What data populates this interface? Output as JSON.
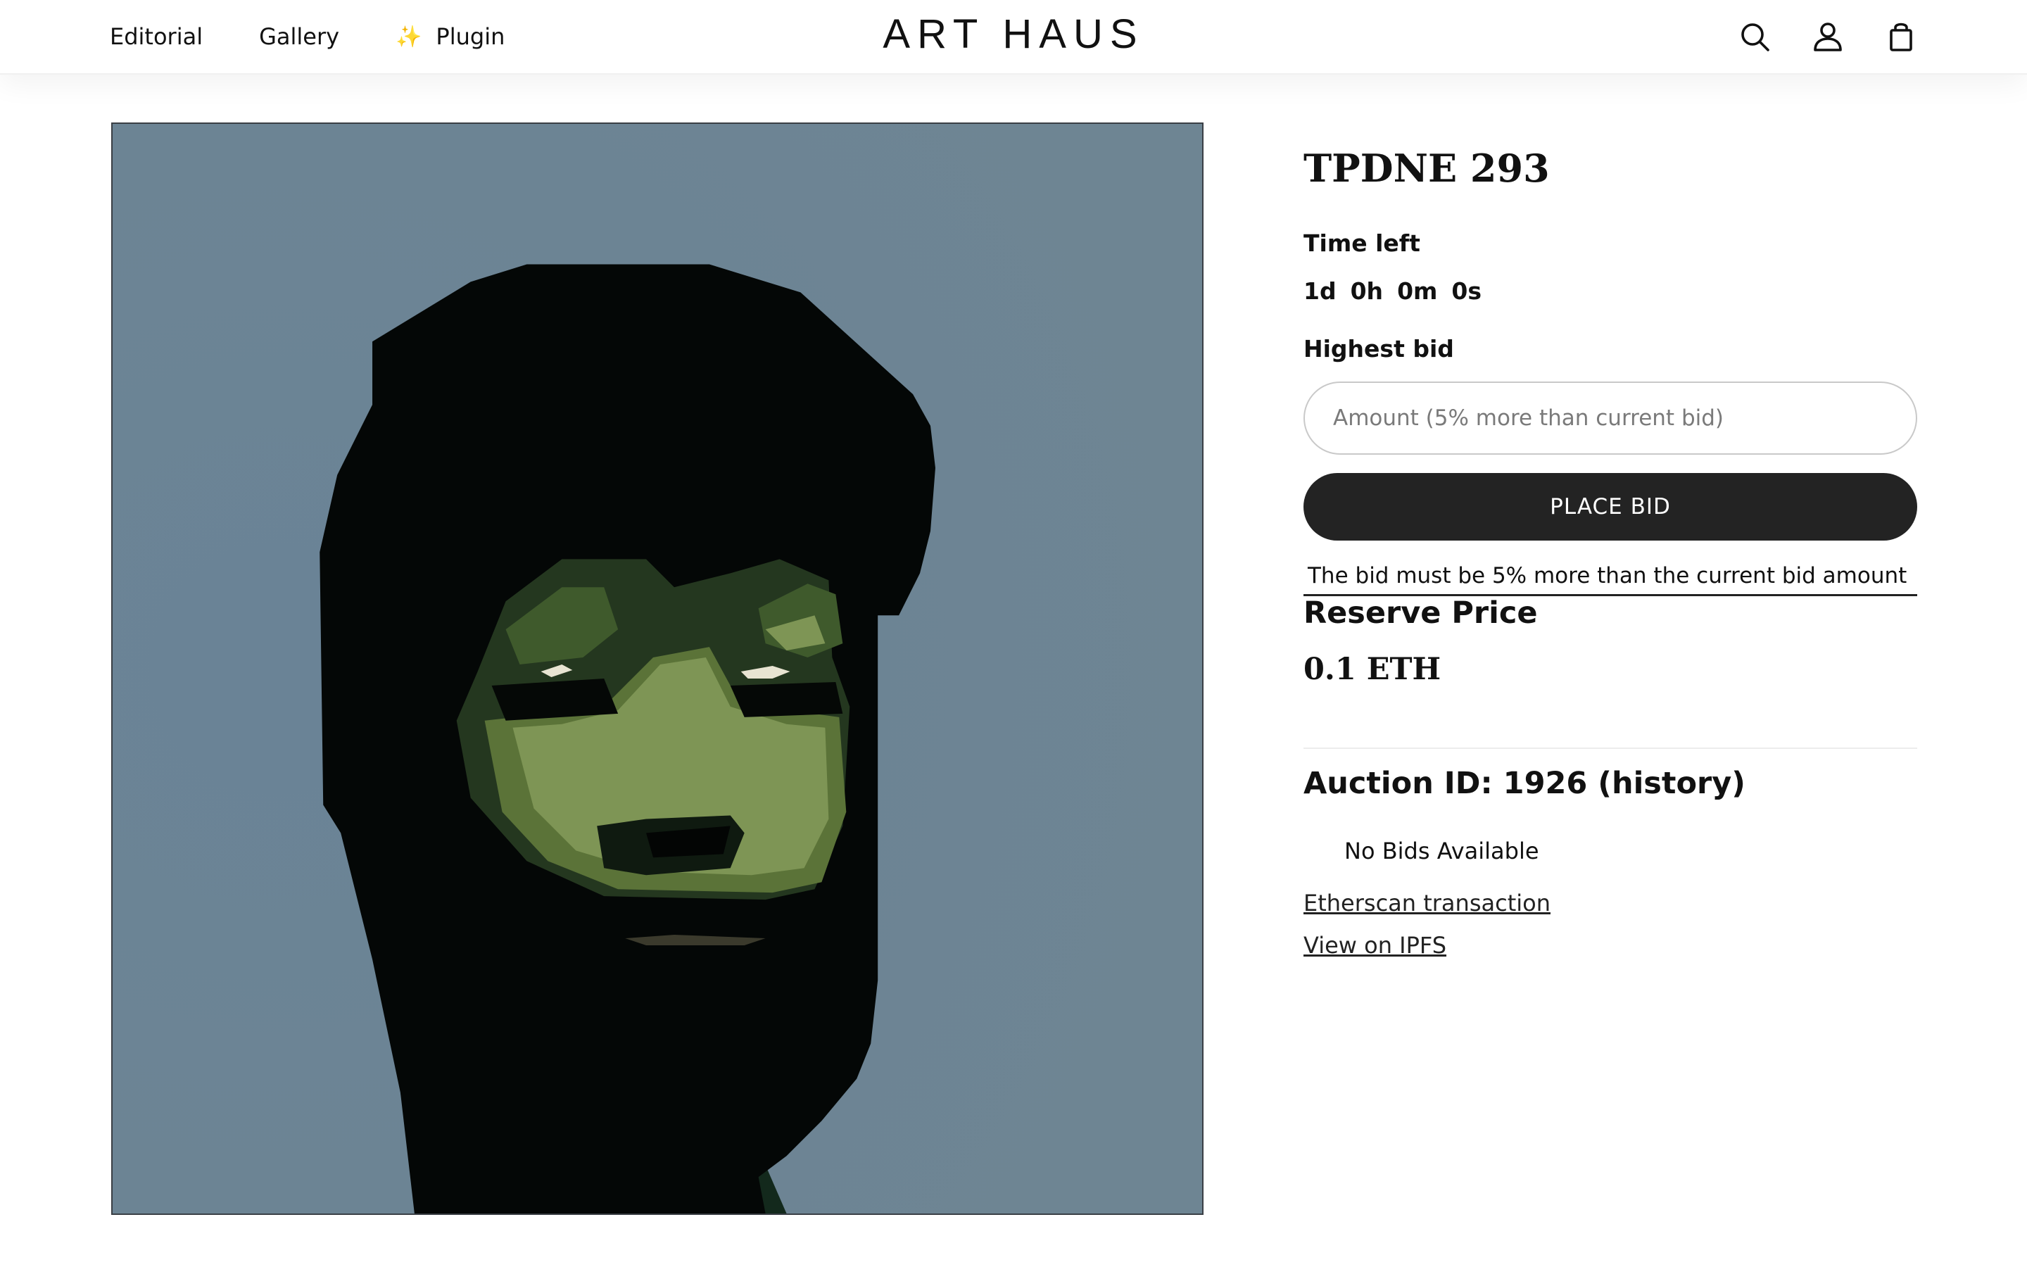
{
  "nav": {
    "links": [
      {
        "label": "Editorial"
      },
      {
        "label": "Gallery"
      },
      {
        "label": "Plugin",
        "icon": "sparkle-icon"
      }
    ],
    "brand": "ART HAUS",
    "icons": [
      "search-icon",
      "account-icon",
      "cart-icon"
    ]
  },
  "artwork": {
    "background_color": "#6e8593",
    "subject": "stylized portrait, black hair and beard, green face"
  },
  "product": {
    "title": "TPDNE 293",
    "time_left_label": "Time left",
    "countdown": {
      "days": "1d",
      "hours": "0h",
      "minutes": "0m",
      "seconds": "0s"
    },
    "highest_bid_label": "Highest bid",
    "bid_placeholder": "Amount (5% more than current bid)",
    "place_bid_label": "PLACE BID",
    "bid_note": "The bid must be 5% more than the current bid amount",
    "reserve_label": "Reserve Price",
    "reserve_value": "0.1 ETH",
    "auction_id": "Auction ID: 1926 (history)",
    "no_bids": "No Bids Available",
    "etherscan_link": "Etherscan transaction",
    "ipfs_link": "View on IPFS"
  },
  "colors": {
    "button_bg": "#232323",
    "accent_sparkle": "#f5c542"
  }
}
